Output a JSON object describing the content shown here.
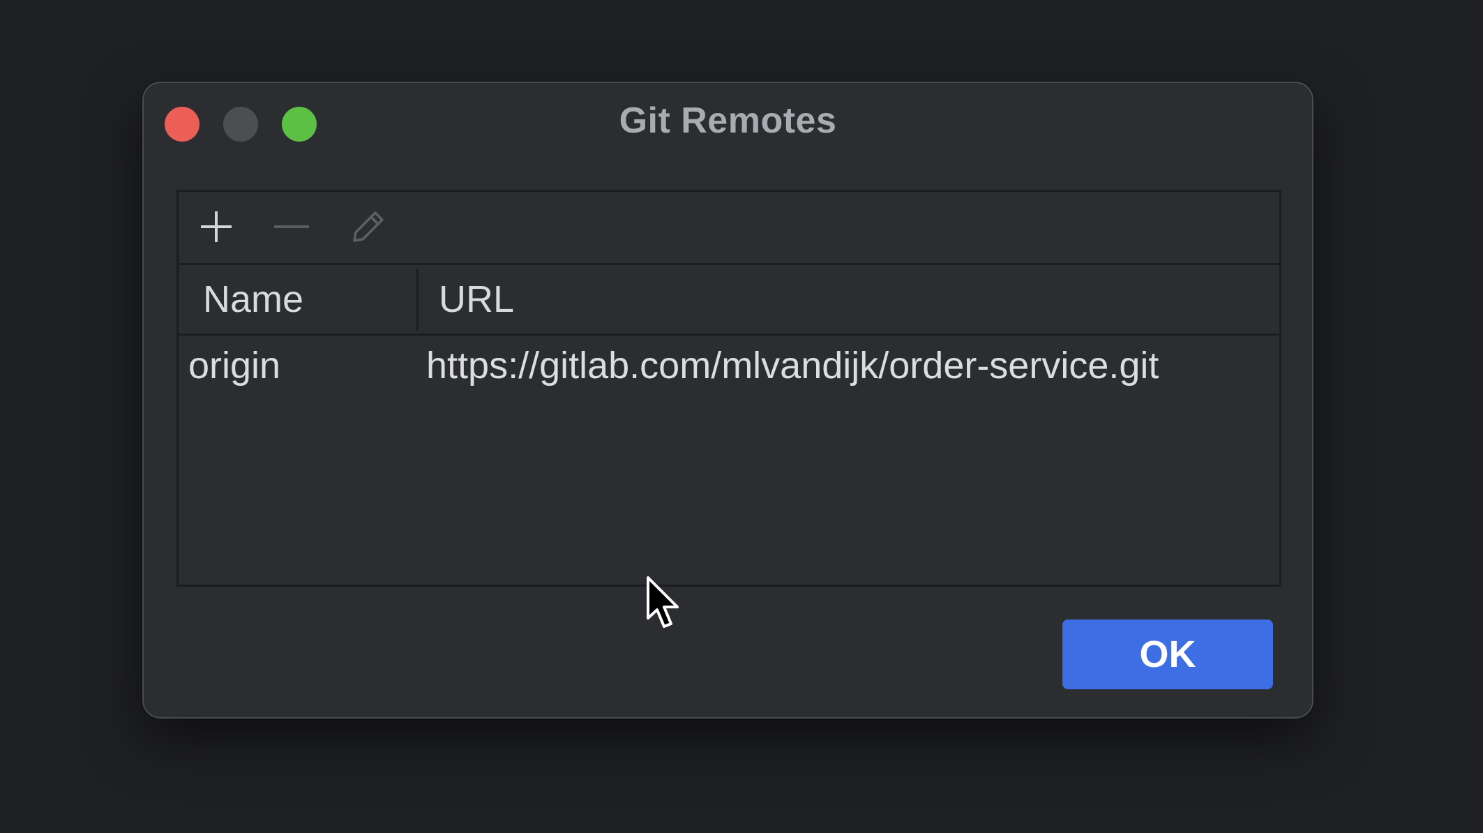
{
  "window": {
    "title": "Git Remotes"
  },
  "toolbar": {
    "add_icon": "plus-icon",
    "remove_icon": "minus-icon",
    "edit_icon": "pencil-icon"
  },
  "table": {
    "columns": [
      "Name",
      "URL"
    ],
    "rows": [
      {
        "name": "origin",
        "url": "https://gitlab.com/mlvandijk/order-service.git"
      }
    ]
  },
  "footer": {
    "ok_label": "OK"
  },
  "colors": {
    "accent": "#3d6ee4",
    "close": "#ec5f57",
    "zoom": "#5cc045"
  }
}
